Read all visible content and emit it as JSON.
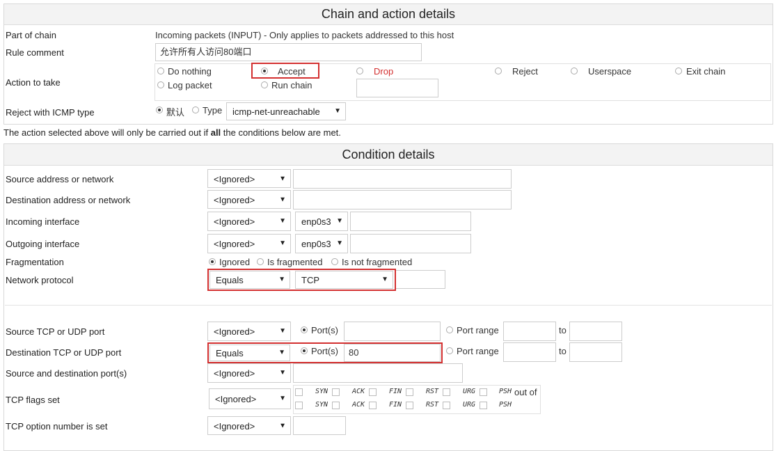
{
  "chain_panel": {
    "title": "Chain and action details",
    "part_of_chain_label": "Part of chain",
    "part_of_chain_value": "Incoming packets (INPUT) - Only applies to packets addressed to this host",
    "rule_comment_label": "Rule comment",
    "rule_comment_value": "允许所有人访问80端口",
    "action_label": "Action to take",
    "actions": {
      "do_nothing": "Do nothing",
      "accept": "Accept",
      "drop": "Drop",
      "reject": "Reject",
      "userspace": "Userspace",
      "exit_chain": "Exit chain",
      "log_packet": "Log packet",
      "run_chain": "Run chain"
    },
    "selected_action": "Accept",
    "reject_label": "Reject with ICMP type",
    "reject_default": "默认",
    "reject_type": "Type",
    "reject_select": "icmp-net-unreachable"
  },
  "note": {
    "before": "The action selected above will only be carried out if ",
    "bold": "all",
    "after": " the conditions below are met."
  },
  "condition_panel": {
    "title": "Condition details",
    "source_address_label": "Source address or network",
    "source_address_mode": "<Ignored>",
    "dest_address_label": "Destination address or network",
    "dest_address_mode": "<Ignored>",
    "incoming_iface_label": "Incoming interface",
    "incoming_iface_mode": "<Ignored>",
    "incoming_iface_select": "enp0s3",
    "outgoing_iface_label": "Outgoing interface",
    "outgoing_iface_mode": "<Ignored>",
    "outgoing_iface_select": "enp0s3",
    "fragmentation_label": "Fragmentation",
    "frag_ignored": "Ignored",
    "frag_is": "Is fragmented",
    "frag_not": "Is not fragmented",
    "protocol_label": "Network protocol",
    "protocol_mode": "Equals",
    "protocol_value": "TCP",
    "src_port_label": "Source TCP or UDP port",
    "src_port_mode": "<Ignored>",
    "ports_label": "Port(s)",
    "port_range_label": "Port range",
    "to_label": "to",
    "dst_port_label": "Destination TCP or UDP port",
    "dst_port_mode": "Equals",
    "dst_port_value": "80",
    "src_dst_port_label": "Source and destination port(s)",
    "src_dst_port_mode": "<Ignored>",
    "tcp_flags_label": "TCP flags set",
    "tcp_flags_mode": "<Ignored>",
    "tcp_flags_out_of": "out of",
    "flags": [
      "SYN",
      "ACK",
      "FIN",
      "RST",
      "URG",
      "PSH"
    ],
    "tcp_option_label": "TCP option number is set",
    "tcp_option_mode": "<Ignored>"
  },
  "colors": {
    "highlight": "#d32f2f",
    "drop_text": "#d32f2f"
  }
}
